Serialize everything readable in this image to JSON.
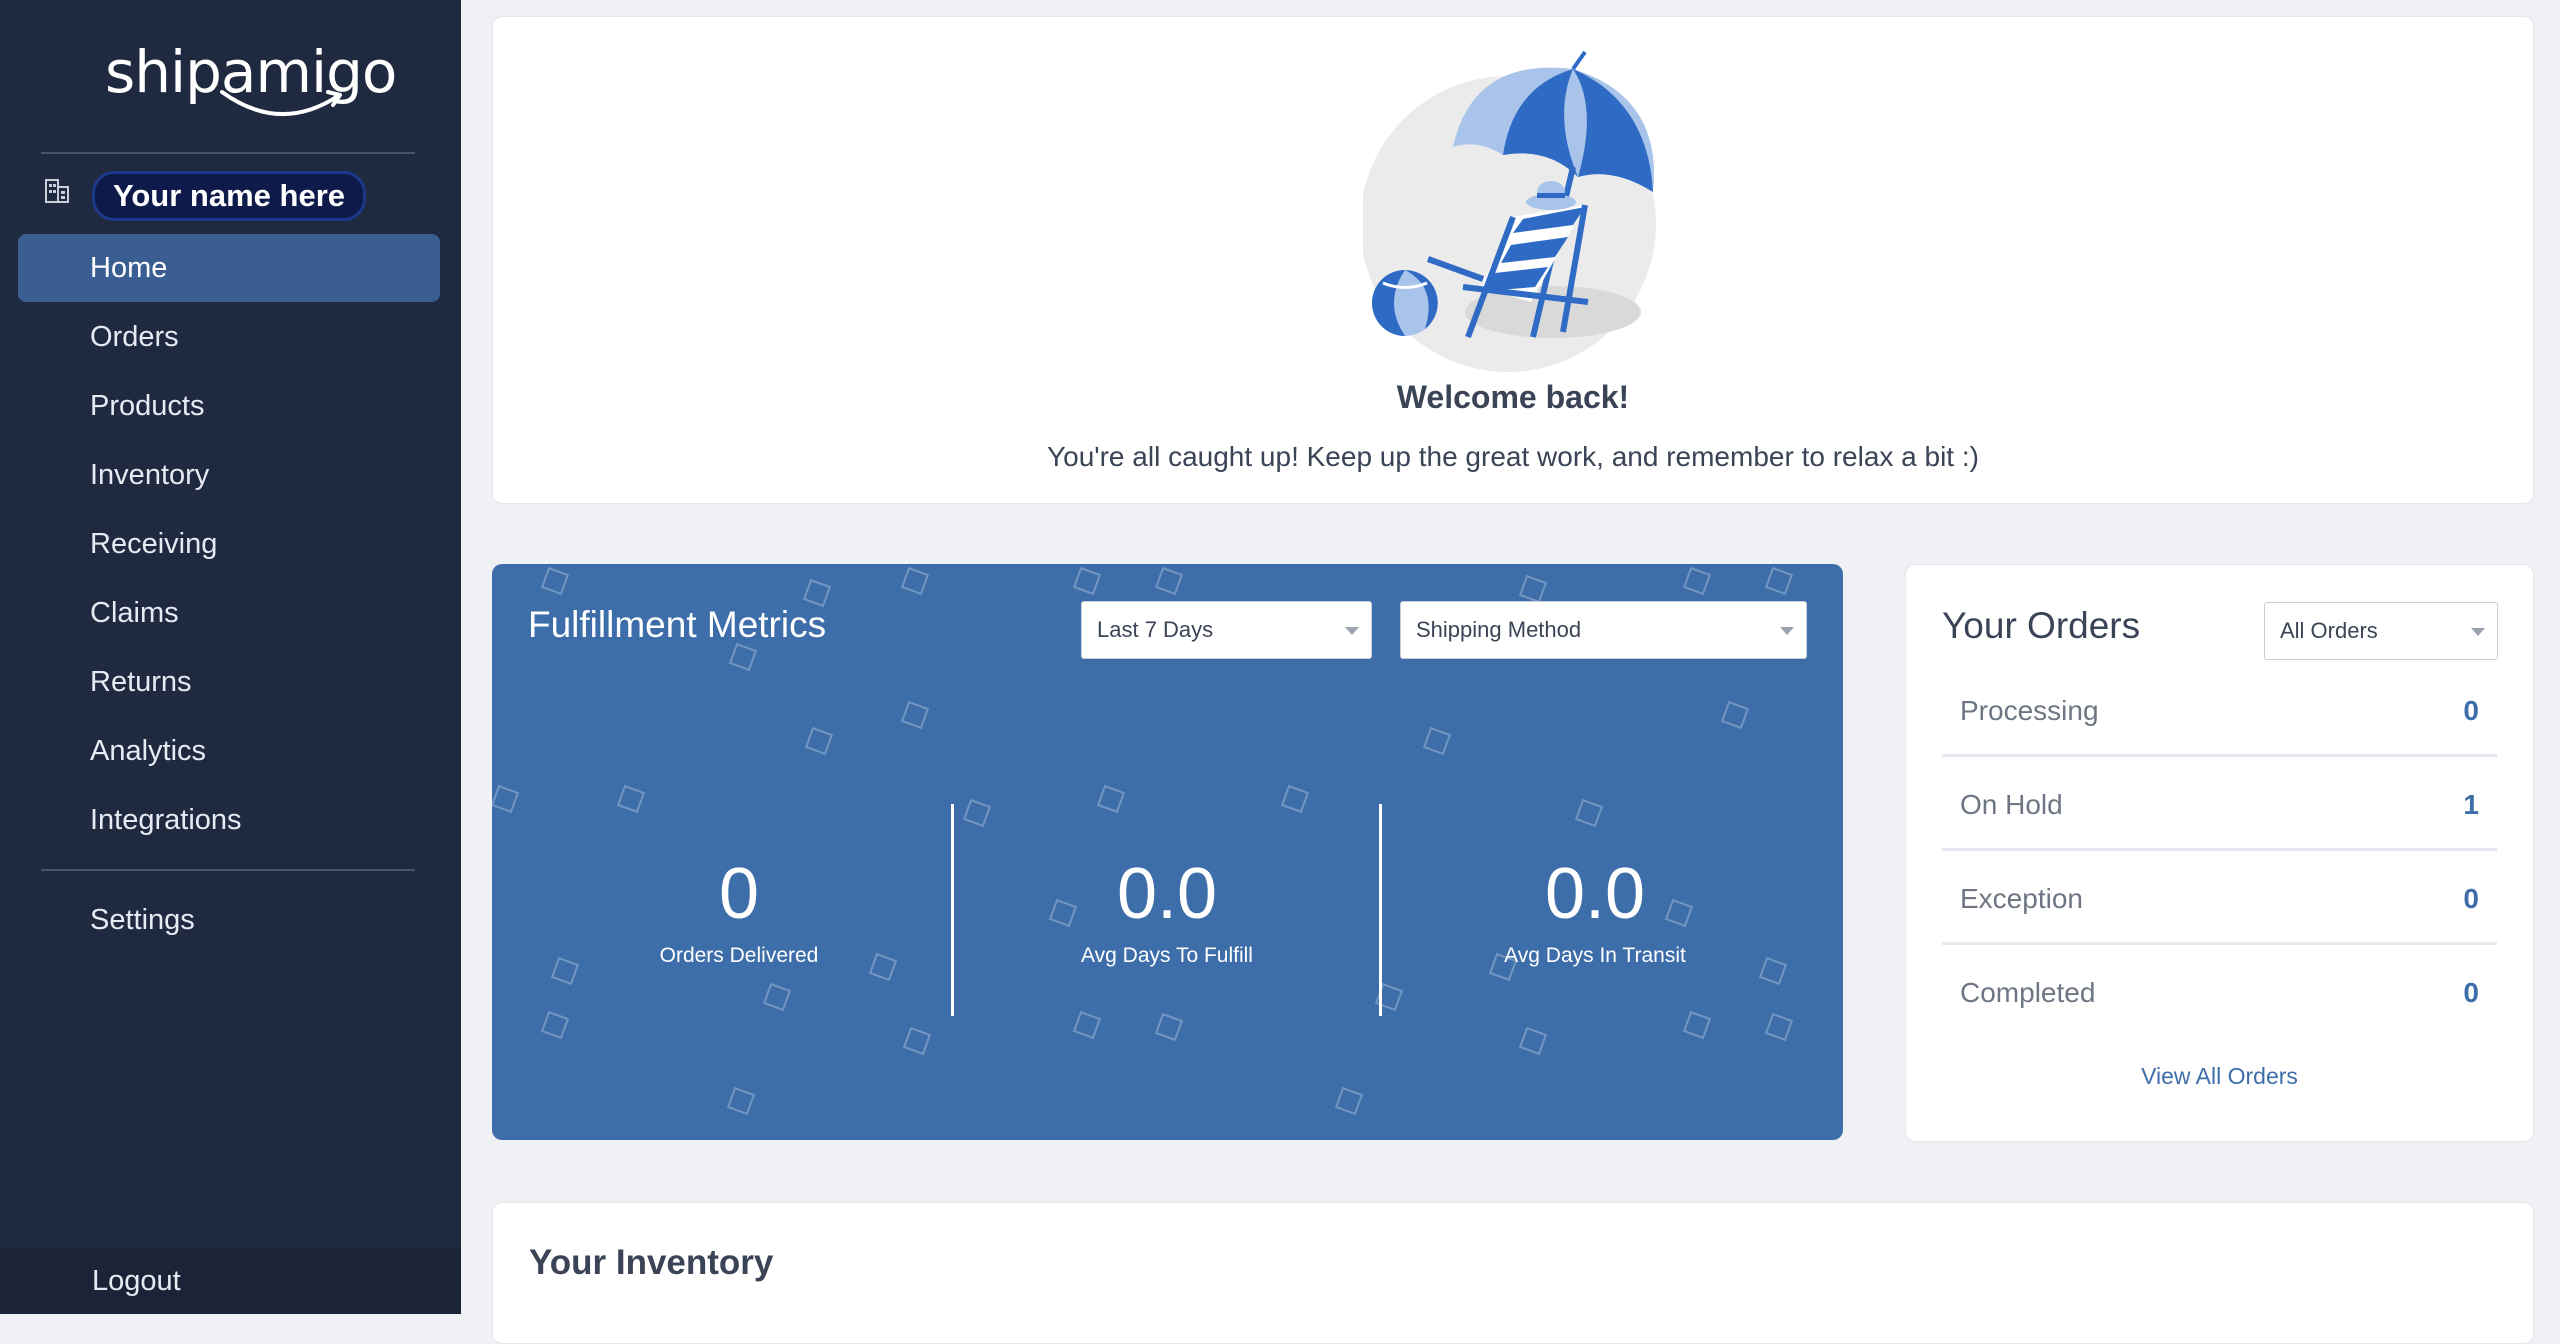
{
  "brand": {
    "logo_text": "shipamigo"
  },
  "sidebar": {
    "company_name": "Your name here",
    "items": [
      {
        "label": "Home",
        "active": true
      },
      {
        "label": "Orders"
      },
      {
        "label": "Products"
      },
      {
        "label": "Inventory"
      },
      {
        "label": "Receiving"
      },
      {
        "label": "Claims"
      },
      {
        "label": "Returns"
      },
      {
        "label": "Analytics"
      },
      {
        "label": "Integrations"
      }
    ],
    "settings_label": "Settings",
    "logout_label": "Logout"
  },
  "welcome": {
    "title": "Welcome back!",
    "message": "You're all caught up! Keep up the great work, and remember to relax a bit :)"
  },
  "fulfillment": {
    "title": "Fulfillment Metrics",
    "date_filter": "Last 7 Days",
    "shipping_filter": "Shipping Method",
    "metrics": [
      {
        "value": "0",
        "label": "Orders Delivered"
      },
      {
        "value": "0.0",
        "label": "Avg Days To Fulfill"
      },
      {
        "value": "0.0",
        "label": "Avg Days In Transit"
      }
    ]
  },
  "orders": {
    "title": "Your Orders",
    "filter": "All Orders",
    "rows": [
      {
        "label": "Processing",
        "count": "0"
      },
      {
        "label": "On Hold",
        "count": "1"
      },
      {
        "label": "Exception",
        "count": "0"
      },
      {
        "label": "Completed",
        "count": "0"
      }
    ],
    "view_all": "View All Orders"
  },
  "inventory": {
    "title": "Your Inventory"
  },
  "colors": {
    "sidebar": "#1f2940",
    "active": "#3a5e92",
    "accent": "#3d6eaa"
  }
}
